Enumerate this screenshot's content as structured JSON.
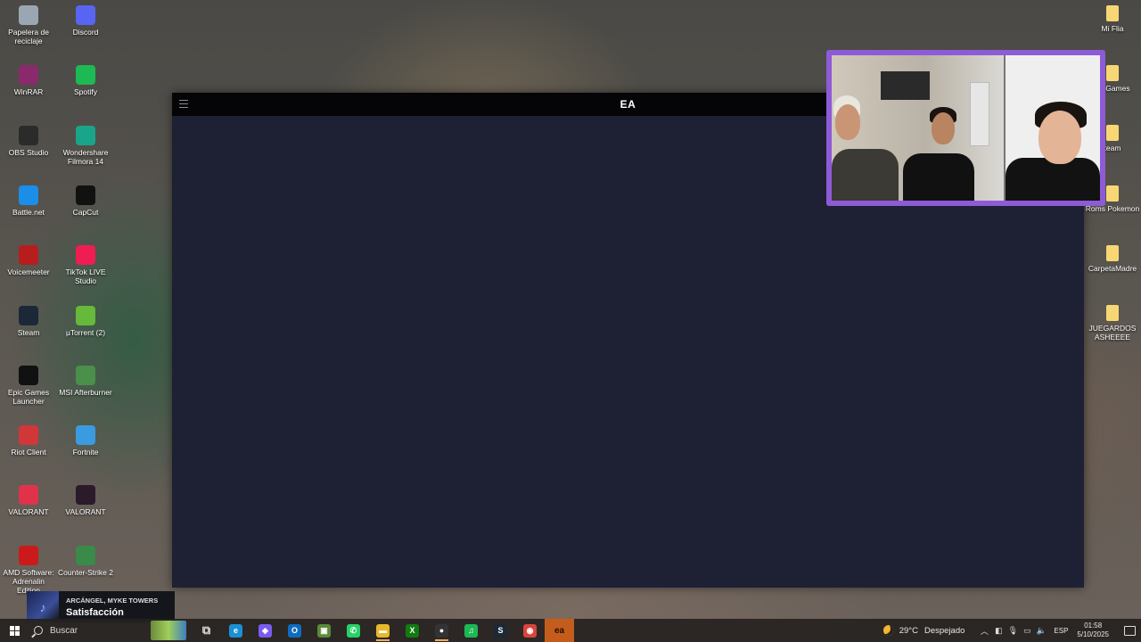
{
  "desktop": {
    "left_col": [
      {
        "label": "Papelera de reciclaje",
        "icon": "recycle-bin-icon",
        "color": "#9aa7b3"
      },
      {
        "label": "WinRAR",
        "icon": "winrar-icon",
        "color": "#8a2a6d"
      },
      {
        "label": "OBS Studio",
        "icon": "obs-icon",
        "color": "#2b2b2b"
      },
      {
        "label": "Battle.net",
        "icon": "battlenet-icon",
        "color": "#1a8ee8"
      },
      {
        "label": "Voicemeeter",
        "icon": "voicemeeter-icon",
        "color": "#b81d1d"
      },
      {
        "label": "Steam",
        "icon": "steam-icon",
        "color": "#1b2838"
      },
      {
        "label": "Epic Games Launcher",
        "icon": "epic-games-icon",
        "color": "#111111"
      },
      {
        "label": "Riot Client",
        "icon": "riot-client-icon",
        "color": "#d13639"
      },
      {
        "label": "VALORANT",
        "icon": "valorant-icon",
        "color": "#e0334b"
      },
      {
        "label": "AMD Software: Adrenalin Edition",
        "icon": "amd-icon",
        "color": "#cc1a1a"
      }
    ],
    "right_col": [
      {
        "label": "Discord",
        "icon": "discord-icon",
        "color": "#5865f2"
      },
      {
        "label": "Spotify",
        "icon": "spotify-icon",
        "color": "#1db954"
      },
      {
        "label": "Wondershare Filmora 14",
        "icon": "filmora-icon",
        "color": "#19a58a"
      },
      {
        "label": "CapCut",
        "icon": "capcut-icon",
        "color": "#111111"
      },
      {
        "label": "TikTok LIVE Studio",
        "icon": "tiktok-live-icon",
        "color": "#ee1d52"
      },
      {
        "label": "µTorrent (2)",
        "icon": "utorrent-icon",
        "color": "#66b93b"
      },
      {
        "label": "MSI Afterburner",
        "icon": "msi-afterburner-icon",
        "color": "#4a8f4a"
      },
      {
        "label": "Fortnite",
        "icon": "fortnite-icon",
        "color": "#3a9be0"
      },
      {
        "label": "VALORANT",
        "icon": "valorant-icon",
        "color": "#2a1a2a"
      },
      {
        "label": "Counter-Strike 2",
        "icon": "counter-strike-icon",
        "color": "#3a8a4a"
      }
    ],
    "far_right": [
      {
        "label": "Mi Flia",
        "icon": "folder-icon"
      },
      {
        "label": "de Games",
        "icon": "folder-icon"
      },
      {
        "label": "team",
        "icon": "folder-icon"
      },
      {
        "label": "Roms Pokemon",
        "icon": "folder-icon"
      },
      {
        "label": "CarpetaMadre",
        "icon": "folder-icon"
      },
      {
        "label": "JUEGARDOS ASHEEEE",
        "icon": "folder-icon"
      }
    ]
  },
  "ea_window": {
    "title": "EA",
    "menu_icon": "hamburger-icon",
    "bg_color": "#1e2033"
  },
  "webcam": {
    "border_color": "#8e5bd6"
  },
  "music": {
    "artist": "ARCÁNGEL, MYKE TOWERS",
    "song": "Satisfacción"
  },
  "taskbar": {
    "search_placeholder": "Buscar",
    "apps": [
      {
        "name": "task-view-icon",
        "glyph": "⧉",
        "color": "transparent"
      },
      {
        "name": "edge-icon",
        "glyph": "e",
        "color": "#1b8fd3"
      },
      {
        "name": "copilot-icon",
        "glyph": "◆",
        "color": "#7a5cf0"
      },
      {
        "name": "outlook-icon",
        "glyph": "O",
        "color": "#0f6cbd"
      },
      {
        "name": "minecraft-icon",
        "glyph": "▣",
        "color": "#5a8a3a"
      },
      {
        "name": "whatsapp-icon",
        "glyph": "✆",
        "color": "#25d366"
      },
      {
        "name": "file-explorer-icon",
        "glyph": "▬",
        "color": "#e8b82c"
      },
      {
        "name": "xbox-icon",
        "glyph": "X",
        "color": "#107c10"
      },
      {
        "name": "obs-icon",
        "glyph": "●",
        "color": "#333333"
      },
      {
        "name": "spotify-icon",
        "glyph": "♫",
        "color": "#1db954"
      },
      {
        "name": "steam-icon",
        "glyph": "S",
        "color": "#1b2838"
      },
      {
        "name": "chrome-icon",
        "glyph": "◉",
        "color": "#d8453a"
      },
      {
        "name": "ea-app-icon",
        "glyph": "ea",
        "color": "#ff4747"
      }
    ],
    "weather_temp": "29°C",
    "weather_text": "Despejado",
    "language": "ESP",
    "time": "01:58",
    "date": "5/10/2025"
  }
}
